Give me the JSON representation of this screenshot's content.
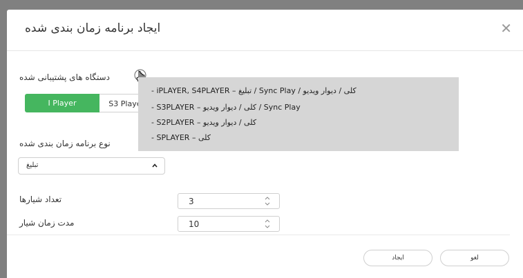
{
  "dialog": {
    "title": "ایجاد برنامه زمان بندی شده",
    "close_symbol": "✕"
  },
  "supported_devices": {
    "label": "دستگاه های پشتیبانی شده",
    "tabs": [
      {
        "label": "I Player",
        "active": true
      },
      {
        "label": "S3 Player",
        "active": false
      }
    ]
  },
  "schedule_type": {
    "label": "نوع برنامه زمان بندی شده",
    "value": "تبلیغ"
  },
  "slot_count": {
    "label": "تعداد شیارها",
    "value": "3"
  },
  "slot_duration": {
    "label": "مدت زمان شیار",
    "value": "10"
  },
  "footer": {
    "create_label": "ایجاد",
    "cancel_label": "لغو"
  },
  "tooltip": {
    "lines": [
      "- iPLAYER, S4PLAYER – تبلیغ / Sync Play / کلی / دیوار ویدیو",
      "- S3PLAYER – کلی / دیوار ویدیو / Sync Play",
      "- S2PLAYER – کلی / دیوار ویدیو",
      "- SPLAYER – کلی"
    ]
  },
  "colors": {
    "accent": "#45b65f",
    "overlay": "#808080",
    "tooltip_bg": "#d6d6d6"
  }
}
